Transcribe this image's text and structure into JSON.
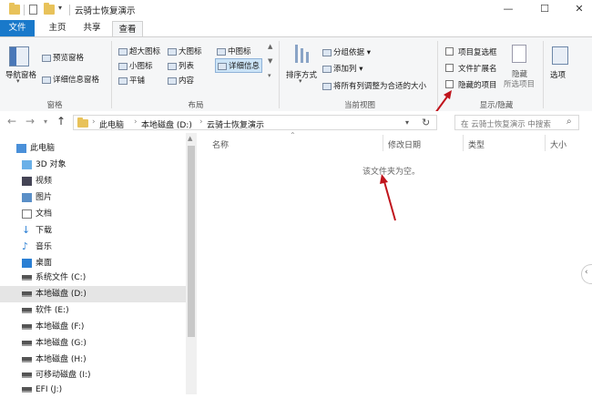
{
  "titlebar": {
    "title": "云骑士恢复演示",
    "minimize": "—",
    "maximize": "☐",
    "close": "✕"
  },
  "tabs": [
    "文件",
    "主页",
    "共享",
    "查看"
  ],
  "ribbon": {
    "pane": {
      "nav_pane": "导航窗格",
      "preview": "预览窗格",
      "details": "详细信息窗格",
      "label": "窗格"
    },
    "layout": {
      "items": [
        "超大图标",
        "大图标",
        "中图标",
        "小图标",
        "列表",
        "详细信息",
        "平铺",
        "内容"
      ],
      "label": "布局"
    },
    "current_view": {
      "sort": "排序方式",
      "group": "分组依据 ▾",
      "add_col": "添加列 ▾",
      "fit_cols": "将所有列调整为合适的大小",
      "label": "当前视图"
    },
    "show_hide": {
      "item_checkbox": "项目复选框",
      "file_ext": "文件扩展名",
      "hidden_items": "隐藏的项目",
      "hide": "隐藏",
      "hide_sub": "所选项目",
      "label": "显示/隐藏"
    },
    "options": "选项"
  },
  "address": {
    "crumbs": [
      "此电脑",
      "本地磁盘 (D:)",
      "云骑士恢复演示"
    ],
    "search_placeholder": "在 云骑士恢复演示 中搜索"
  },
  "tree": [
    "此电脑",
    "3D 对象",
    "视频",
    "图片",
    "文档",
    "下载",
    "音乐",
    "桌面",
    "系统文件 (C:)",
    "本地磁盘 (D:)",
    "软件 (E:)",
    "本地磁盘 (F:)",
    "本地磁盘 (G:)",
    "本地磁盘 (H:)",
    "可移动磁盘 (I:)",
    "EFI (J:)"
  ],
  "columns": [
    "名称",
    "修改日期",
    "类型",
    "大小"
  ],
  "empty_message": "该文件夹为空。",
  "colors": {
    "accent": "#1979ca",
    "annotation": "#c0141c"
  }
}
